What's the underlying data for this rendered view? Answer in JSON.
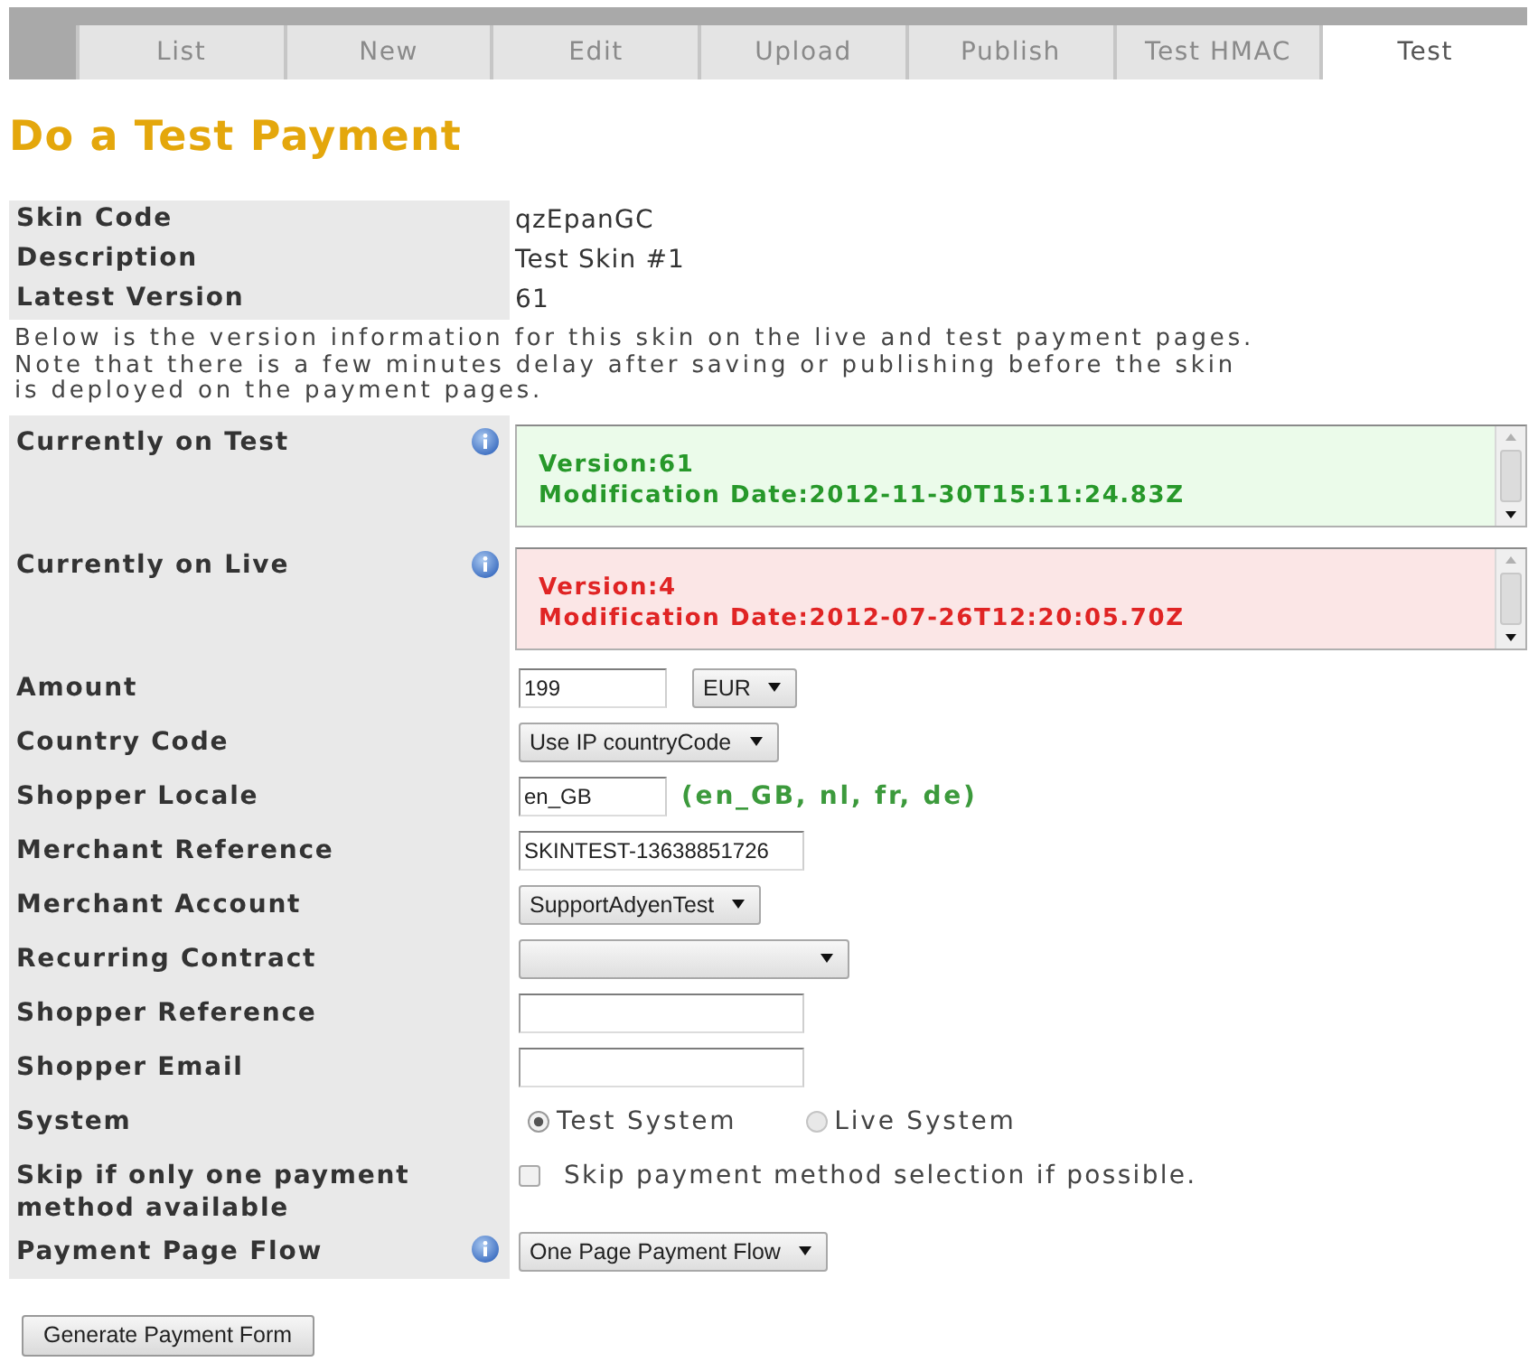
{
  "tabs": [
    {
      "label": "List",
      "selected": false
    },
    {
      "label": "New",
      "selected": false
    },
    {
      "label": "Edit",
      "selected": false
    },
    {
      "label": "Upload",
      "selected": false
    },
    {
      "label": "Publish",
      "selected": false
    },
    {
      "label": "Test HMAC",
      "selected": false
    },
    {
      "label": "Test",
      "selected": true
    }
  ],
  "title": "Do a Test Payment",
  "skin_details": [
    {
      "label": "Skin Code",
      "value": "qzEpanGC"
    },
    {
      "label": "Description",
      "value": "Test Skin #1"
    },
    {
      "label": "Latest Version",
      "value": "61"
    }
  ],
  "note_lines": [
    "Below is the version information for this skin on the live and test payment pages.",
    "Note that there is a few minutes delay after saving or publishing before the skin",
    "is deployed on the payment pages."
  ],
  "versions": [
    {
      "label": "Currently on Test",
      "kind": "test",
      "help": true,
      "lines": [
        "Version:61",
        "Modification Date:2012-11-30T15:11:24.83Z"
      ]
    },
    {
      "label": "Currently on Live",
      "kind": "live",
      "help": true,
      "lines": [
        "Version:4",
        "Modification Date:2012-07-26T12:20:05.70Z"
      ]
    }
  ],
  "form": [
    {
      "label": "Amount",
      "controls": [
        {
          "kind": "input",
          "value": "199"
        },
        {
          "kind": "select",
          "value": "EUR"
        }
      ]
    },
    {
      "label": "Country Code",
      "controls": [
        {
          "kind": "select",
          "value": "Use IP countryCode"
        }
      ]
    },
    {
      "label": "Shopper Locale",
      "controls": [
        {
          "kind": "input",
          "value": "en_GB"
        },
        {
          "kind": "hint",
          "text": "(en_GB, nl, fr, de)"
        }
      ]
    },
    {
      "label": "Merchant Reference",
      "controls": [
        {
          "kind": "input",
          "value": "SKINTEST-13638851726"
        }
      ]
    },
    {
      "label": "Merchant Account",
      "controls": [
        {
          "kind": "select",
          "value": "SupportAdyenTest"
        }
      ]
    },
    {
      "label": "Recurring Contract",
      "controls": [
        {
          "kind": "select"
        }
      ]
    },
    {
      "label": "Shopper Reference",
      "controls": [
        {
          "kind": "input"
        }
      ]
    },
    {
      "label": "Shopper Email",
      "controls": [
        {
          "kind": "input"
        }
      ]
    },
    {
      "label": "System",
      "controls": [
        {
          "kind": "radio",
          "label": "Test System",
          "selected": true
        },
        {
          "kind": "radio",
          "label": "Live System",
          "selected": false
        }
      ]
    },
    {
      "label": "Skip if only one payment method available",
      "controls": [
        {
          "kind": "checkbox",
          "label": "Skip payment method selection if possible.",
          "checked": false
        }
      ]
    },
    {
      "label": "Payment Page Flow",
      "help": true,
      "controls": [
        {
          "kind": "select",
          "value": "One Page Payment Flow"
        }
      ]
    }
  ],
  "submit_button": "Generate Payment Form"
}
